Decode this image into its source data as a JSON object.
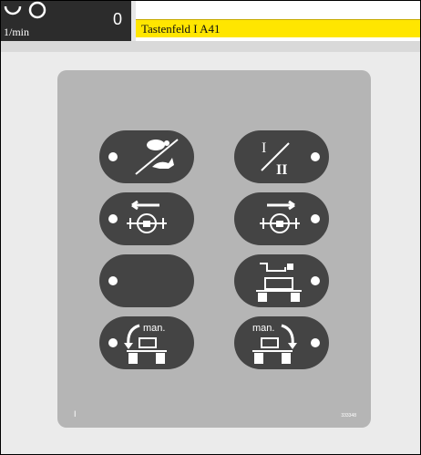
{
  "header": {
    "rpm_value": "0",
    "rpm_unit": "1/min",
    "title": "Tastenfeld I A41"
  },
  "panel": {
    "id_label": "I",
    "part_number": "333348",
    "keys": [
      {
        "name": "speed-range-key",
        "icon": "turtle-hare-icon",
        "text": ""
      },
      {
        "name": "gear-I-II-key",
        "icon": "I-II-icon",
        "text": "I II"
      },
      {
        "name": "axle-left-key",
        "icon": "axle-lock-left-icon",
        "text": ""
      },
      {
        "name": "axle-right-key",
        "icon": "axle-lock-right-icon",
        "text": ""
      },
      {
        "name": "empty-key",
        "icon": "",
        "text": ""
      },
      {
        "name": "hitch-lock-key",
        "icon": "hitch-lock-icon",
        "text": ""
      },
      {
        "name": "manual-left-key",
        "icon": "manual-left-icon",
        "text": "man."
      },
      {
        "name": "manual-right-key",
        "icon": "manual-right-icon",
        "text": "man."
      }
    ]
  }
}
